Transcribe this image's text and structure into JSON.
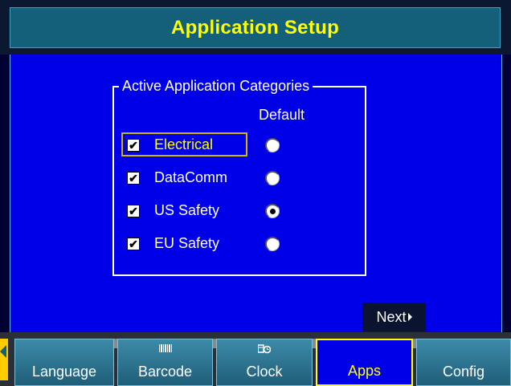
{
  "header": {
    "title": "Application Setup"
  },
  "group": {
    "legend": "Active Application Categories",
    "default_label": "Default",
    "categories": [
      {
        "label": "Electrical",
        "checked": true,
        "default": false,
        "focused": true
      },
      {
        "label": "DataComm",
        "checked": true,
        "default": false,
        "focused": false
      },
      {
        "label": "US Safety",
        "checked": true,
        "default": true,
        "focused": false
      },
      {
        "label": "EU Safety",
        "checked": true,
        "default": false,
        "focused": false
      }
    ]
  },
  "next_button": {
    "label": "Next"
  },
  "tabs": [
    {
      "label": "Language",
      "icon": "",
      "active": false
    },
    {
      "label": "Barcode",
      "icon": "barcode-icon",
      "active": false
    },
    {
      "label": "Clock",
      "icon": "clock-icon",
      "active": false
    },
    {
      "label": "Apps",
      "icon": "",
      "active": true
    },
    {
      "label": "Config",
      "icon": "",
      "active": false
    }
  ],
  "colors": {
    "background": "#0000e8",
    "title": "#ffff00",
    "focus": "#d4b800",
    "tab": "#2f7a98"
  }
}
